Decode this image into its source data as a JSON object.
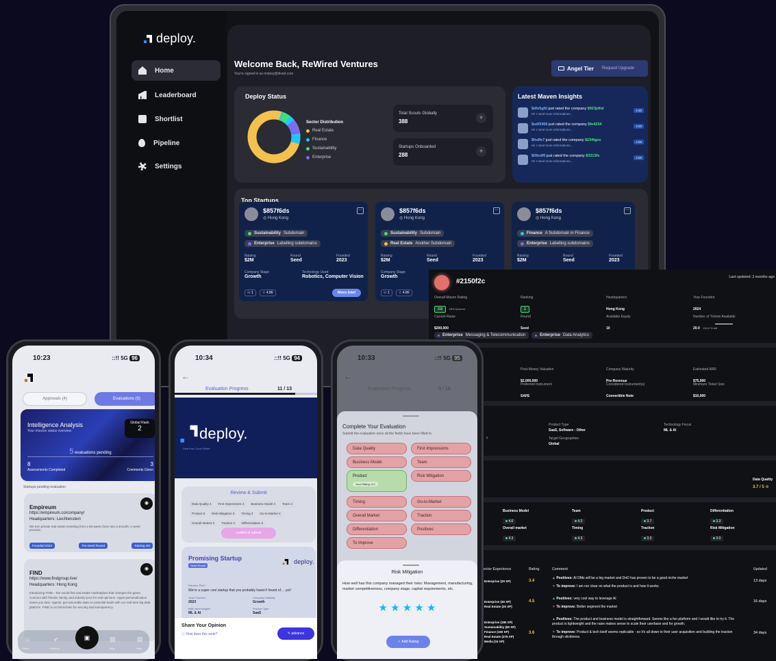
{
  "laptop": {
    "logo": "deploy.",
    "nav": [
      "Home",
      "Leaderboard",
      "Shortlist",
      "Pipeline",
      "Settings"
    ],
    "welcome": "Welcome Back, ReWired Ventures",
    "signed_in": "You're signed in as mobey@dived.com",
    "tier_label": "Angel Tier",
    "upgrade_label": "Request Upgrade",
    "deploy_status": {
      "title": "Deploy Status",
      "sector_title": "Sector Distribution",
      "sectors": [
        "Real Estate",
        "Finance",
        "Sustainability",
        "Enterprise"
      ],
      "sector_colors": [
        "#f2c14e",
        "#20c6ff",
        "#3ee07a",
        "#7b6cf0"
      ],
      "total_scouts_label": "Total Scouts Globally",
      "total_scouts": "388",
      "onboarded_label": "Startups Onboarded",
      "onboarded": "288"
    },
    "insights": {
      "title": "Latest Maven Insights",
      "items": [
        {
          "user": "$dfe5gfd",
          "text": "just rated the company",
          "company": "$923jdhd",
          "sub": "Hi! I need more informations...",
          "score": "4.56"
        },
        {
          "user": "$sdf3456",
          "text": "just rated the company",
          "company": "$fe4234",
          "sub": "Hi! I need more informations...",
          "score": "4.00"
        },
        {
          "user": "$fsdfe7",
          "text": "just rated the company",
          "company": "$234tges",
          "sub": "Hi! I need more informations...",
          "score": "4.56"
        },
        {
          "user": "$09sdf0",
          "text": "just rated the company",
          "company": "$3213fs",
          "sub": "Hi! I need more informations...",
          "score": "4.56"
        }
      ]
    },
    "top_startups": {
      "title": "Top Startups",
      "cards": [
        {
          "name": "$857f6ds",
          "location": "Hong Kong",
          "tag1": "Sustainability",
          "tag1_sub": "Subdomain",
          "tag1_color": "#3ee07a",
          "tag2": "Enterprise",
          "tag2_sub": "Labelling subdomains",
          "tag2_color": "#7b6cf0",
          "raising_label": "Raising",
          "raising": "$2M",
          "round_label": "Round",
          "round": "Seed",
          "founded_label": "Founded",
          "founded": "2023",
          "stage_label": "Company Stage",
          "stage": "Growth",
          "tech_label": "Technology Used",
          "tech": "Robotics, Computer Vision",
          "stat1": "1",
          "stat2": "4.86",
          "more": "More Intel"
        },
        {
          "name": "$857f6ds",
          "location": "Hong Kong",
          "tag1": "Sustainability",
          "tag1_sub": "Subdomain",
          "tag1_color": "#3ee07a",
          "tag2": "Real Estate",
          "tag2_sub": "Another Subdomain",
          "tag2_color": "#f2c14e",
          "raising_label": "Raising",
          "raising": "$2M",
          "round_label": "Round",
          "round": "Seed",
          "founded_label": "Founded",
          "founded": "2023",
          "stage_label": "Company Stage",
          "stage": "Growth",
          "stat1": "1",
          "stat2": "4.86"
        },
        {
          "name": "$857f6ds",
          "location": "Hong Kong",
          "tag1": "Finance",
          "tag1_sub": "A Subdomain in Finance",
          "tag1_color": "#20c6ff",
          "tag2": "Enterprise",
          "tag2_sub": "Labelling subdomains",
          "tag2_color": "#7b6cf0",
          "raising_label": "Raising",
          "raising": "$2M",
          "round_label": "Round",
          "round": "Seed",
          "founded_label": "Founded",
          "founded": "2023"
        }
      ]
    }
  },
  "detail": {
    "id": "#2150f2c",
    "updated": "Last updated: 2 months ago",
    "row1": [
      {
        "label": "Overall Maven Rating",
        "value": "3.8",
        "extra": "18% Quorum"
      },
      {
        "label": "Ranking",
        "value": "1"
      },
      {
        "label": "Headquarters",
        "value": "Hong Kong"
      },
      {
        "label": "Year Founded",
        "value": "2024"
      }
    ],
    "row2": [
      {
        "label": "Current Raise",
        "value": "$200,000"
      },
      {
        "label": "Round",
        "value": "Seed"
      },
      {
        "label": "Available Equity",
        "value": "10"
      },
      {
        "label": "Number of Tickets Available",
        "value": "20.0",
        "extra": "100.0 % left"
      }
    ],
    "tags": [
      {
        "name": "Enterprise",
        "sub": "Messaging & Telecommunication"
      },
      {
        "name": "Enterprise",
        "sub": "Data Analytics"
      }
    ],
    "row3": [
      {
        "label": "Post-Money Valuation",
        "value": "$2,000,000"
      },
      {
        "label": "Company Maturity",
        "value": "Pre-Revenue"
      },
      {
        "label": "Estimated ARR",
        "value": "$75,000"
      }
    ],
    "row4": [
      {
        "label": "Preferred Instrument",
        "value": "SAFE"
      },
      {
        "label": "Considered Instrument(s)",
        "value": "Convertible Note"
      },
      {
        "label": "Minimum Ticket Size",
        "value": "$10,000"
      }
    ],
    "product_type_label": "Product Type",
    "product_type": "SaaS, Software - Other",
    "tech_focus_label": "Technology Focus",
    "tech_focus": "ML & AI",
    "geo_label": "Target Geographies",
    "geo": "Global",
    "dq_label": "Data Quality",
    "dq_value": "3.7 / 5",
    "ratings": [
      {
        "label": "Business Model",
        "value": "4.0"
      },
      {
        "label": "Team",
        "value": "4.3"
      },
      {
        "label": "Product",
        "value": "3.7"
      },
      {
        "label": "Differentiation",
        "value": "3.3"
      },
      {
        "label": "Overall market",
        "value": "4.3"
      },
      {
        "label": "Timing",
        "value": "4.3"
      },
      {
        "label": "Traction",
        "value": "3.3"
      },
      {
        "label": "Risk Mitigation",
        "value": "3.0"
      }
    ],
    "table_headers": [
      "ector Experience",
      "Rating",
      "Comment",
      "Updated"
    ],
    "reviews": [
      {
        "exp": [
          "Enterprise (20 XP)"
        ],
        "rating": "3.4",
        "pos": "AI DMs will be a big market and DnD has proven to be a good niche market",
        "neg": "I am nor clear on what the product is and how it works.",
        "updated": "13 days"
      },
      {
        "exp": [
          "Enterprise (40 XP)",
          "Real Estate (20 XP)"
        ],
        "rating": "4.5",
        "pos": "very cool way to leverage AI",
        "neg": "Better segment the market",
        "updated": "16 days"
      },
      {
        "exp": [
          "Enterprise (180 XP)",
          "Sustainability (80 XP)",
          "Finance (160 XP)",
          "Real Estate (275 XP)",
          "Media (15 XP)"
        ],
        "rating": "3.6",
        "pos": "The product and business model is straightforward. Seems like a fun platform and I would like to try it. The product is lightweight and the raise makes sense to scale their userbase and for growth.",
        "neg": "Product & tech itself seems replicable - so it's all down to their user acquisition and building the traction through stickiness.",
        "updated": "34 days"
      }
    ],
    "pos_label": "Positives:",
    "neg_label": "To improve:"
  },
  "phone1": {
    "time": "10:23",
    "signal": "5G",
    "battery": "96",
    "tab_approvals": "Approvals (4)",
    "tab_evaluations": "Evaluations (5)",
    "intel_title": "Intelligence Analysis",
    "intel_sub": "Your mission status overview",
    "rank_label": "Global Rank",
    "rank": "2",
    "pending_num": "5",
    "pending_text": "evaluations pending",
    "assess_num": "8",
    "assess_label": "Assessments Completed",
    "comments_num": "3",
    "comments_label": "Comments Given",
    "pending_header": "Startups pending evaluation",
    "s1_name": "Empireum",
    "s1_url": "https://empireum.co/company/",
    "s1_hq": "Headquarters: Liechtenstein",
    "s1_desc": "We turn private real estate investing from a 50-week chore into a smooth, 1-week process.",
    "s1_tags": [
      "Founded 2023",
      "Pre-Seed Round",
      "Raising 4M"
    ],
    "s2_name": "FIND",
    "s2_url": "https://www.findgroup.live/",
    "s2_hq": "Headquarters: Hong Kong",
    "s2_desc": "Introducing FIND – the social-first real estate marketplace that changes the game. Connect with friends, family, and industry pros for real opinions. Hyper-personalization saves you time. Agents: get actionable data on potential leads with our real-time big data platform. FIND is on blockchain for security and transparency.",
    "tabbar": [
      "Home",
      "Analysis",
      "",
      "Map",
      "Stats"
    ]
  },
  "phone2": {
    "time": "10:34",
    "signal": "5G",
    "battery": "94",
    "progress_label": "Evaluation Progress",
    "progress": "11 / 13",
    "progress_fraction": 0.846,
    "logo": "deploy.",
    "slide_sub": "Deal flow. Done Better.",
    "review_title": "Review & Submit",
    "tags": [
      "Data Quality 4",
      "First Impressions 4",
      "Business Model 4",
      "Team 4",
      "Product 5",
      "Risk Mitigation 3",
      "Timing 3",
      "Go-to-Market 4",
      "Overall Market 3",
      "Traction 4",
      "Differentiation 5"
    ],
    "confirm": "confirm & submit",
    "promising": "Promising Startup",
    "seed_tag": "Seed Round",
    "pitch_label": "Elevator Pitch",
    "pitch": "We're a super cool startup that you probably haven't heard of.... yet!",
    "f_year_label": "Year Founded",
    "f_year": "2023",
    "f_mat_label": "Company Maturity",
    "f_mat": "Growth",
    "f_tech_label": "Main technologies",
    "f_tech": "ML & AI",
    "f_prod_label": "Product Type",
    "f_prod": "SaaS",
    "share_title": "Share Your Opinion",
    "share_help": "How does this work?",
    "advance": "advance"
  },
  "phone3": {
    "time": "10:33",
    "signal": "5G",
    "battery": "95",
    "progress_label": "Evaluation Progress",
    "progress": "0 / 13",
    "complete_title": "Complete Your Evaluation",
    "complete_sub": "Submit the evaluation once all the fields have been filled in.",
    "left_tags": [
      "Data Quality",
      "Business Model",
      "Timing",
      "Overall Market",
      "Differentiation",
      "To Improve"
    ],
    "right_tags": [
      "First Impressions",
      "Team",
      "Risk Mitigation",
      "Go-to-Market",
      "Traction",
      "Positives"
    ],
    "product_label": "Product",
    "product_rating": "Your Rating: 3.0",
    "sheet_title": "Risk Mitigation",
    "sheet_q": "How well has this company managed their risks: Management, manufacturing, market competitiveness, company stage, capital requirements, etc.",
    "stars": 5,
    "add_rating": "Add Rating"
  }
}
